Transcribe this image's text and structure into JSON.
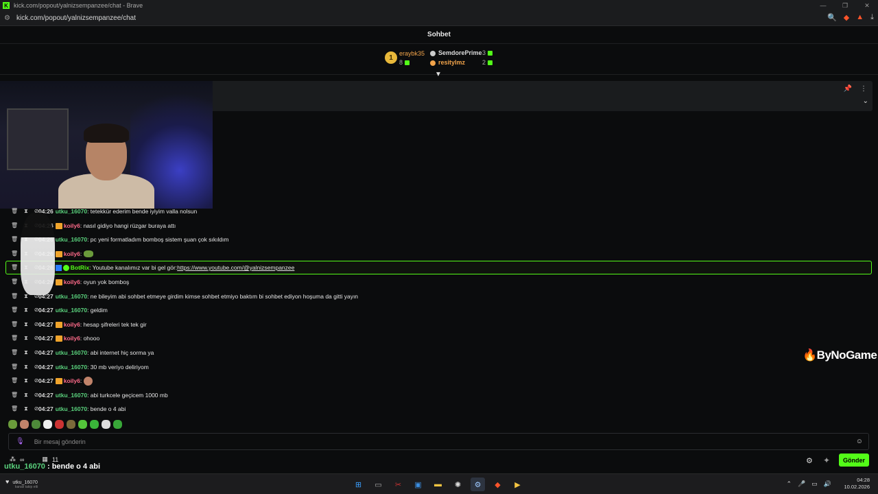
{
  "browser": {
    "title": "kick.com/popout/yalnizsempanzee/chat - Brave",
    "url": "kick.com/popout/yalnizsempanzee/chat"
  },
  "chat": {
    "header": "Sohbet",
    "gifters": {
      "first": {
        "rank": "1",
        "name": "eraybk35",
        "count": "8"
      },
      "second": {
        "name": "SemdorePrime",
        "count": "3"
      },
      "third": {
        "name": "resitylmz",
        "count": "2"
      }
    },
    "messages": [
      {
        "time": "04:26",
        "user": "utku_16070",
        "color": "green",
        "text": ": tetekkür ederim bende iyiyim valla nolsun"
      },
      {
        "time": "04:26",
        "user": "koily6",
        "color": "pink",
        "text": ": nasıl gidiyo hangi rüzgar buraya attı"
      },
      {
        "time": "04:26",
        "user": "utku_16070",
        "color": "green",
        "text": ": pc yeni formatladım bomboş sistem şuan çok sıkıldım"
      },
      {
        "time": "04:26",
        "user": "koily6",
        "color": "pink",
        "text": ":"
      },
      {
        "time": "04:26",
        "user": "BotRix",
        "color": "bot",
        "text": ": Youtube kanalımız var bi gel gör: ",
        "link": "https://www.youtube.com/@yalnizsempanzee"
      },
      {
        "time": "04:26",
        "user": "koily6",
        "color": "pink",
        "text": ": oyun yok bomboş"
      },
      {
        "time": "04:27",
        "user": "utku_16070",
        "color": "green",
        "text": ": ne bileyim abi sohbet etmeye girdim kimse sohbet etmiyo baktım bi sohbet ediyon hoşuma da gitti yayın"
      },
      {
        "time": "04:27",
        "user": "utku_16070",
        "color": "green",
        "text": ": geldim"
      },
      {
        "time": "04:27",
        "user": "koily6",
        "color": "pink",
        "text": ": hesap şifreleri tek tek gir"
      },
      {
        "time": "04:27",
        "user": "koily6",
        "color": "pink",
        "text": ": ohooo"
      },
      {
        "time": "04:27",
        "user": "utku_16070",
        "color": "green",
        "text": ": abi internet hiç sorma ya"
      },
      {
        "time": "04:27",
        "user": "utku_16070",
        "color": "green",
        "text": ": 30 mb veriyo deliriyom"
      },
      {
        "time": "04:27",
        "user": "koily6",
        "color": "pink",
        "text": ":"
      },
      {
        "time": "04:27",
        "user": "utku_16070",
        "color": "green",
        "text": ": abi turkcele geçicem 1000 mb"
      },
      {
        "time": "04:27",
        "user": "utku_16070",
        "color": "green",
        "text": ": bende o 4 abi"
      }
    ],
    "input_placeholder": "Bir mesaj gönderin",
    "send_label": "Gönder",
    "viewer_icon": "∞",
    "calendar_count": "11",
    "overlay_user": "utku_16070",
    "overlay_text": " : bende o 4 abi",
    "sponsor": "ByNoGame"
  },
  "taskbar": {
    "follow_user": "utku_16070",
    "follow_text": "kanalı takip etti",
    "time": "04:28",
    "date": "10.02.2026"
  },
  "colors": {
    "kick_green": "#53fc18",
    "user_green": "#5ad27d",
    "user_pink": "#ff6b8a"
  }
}
